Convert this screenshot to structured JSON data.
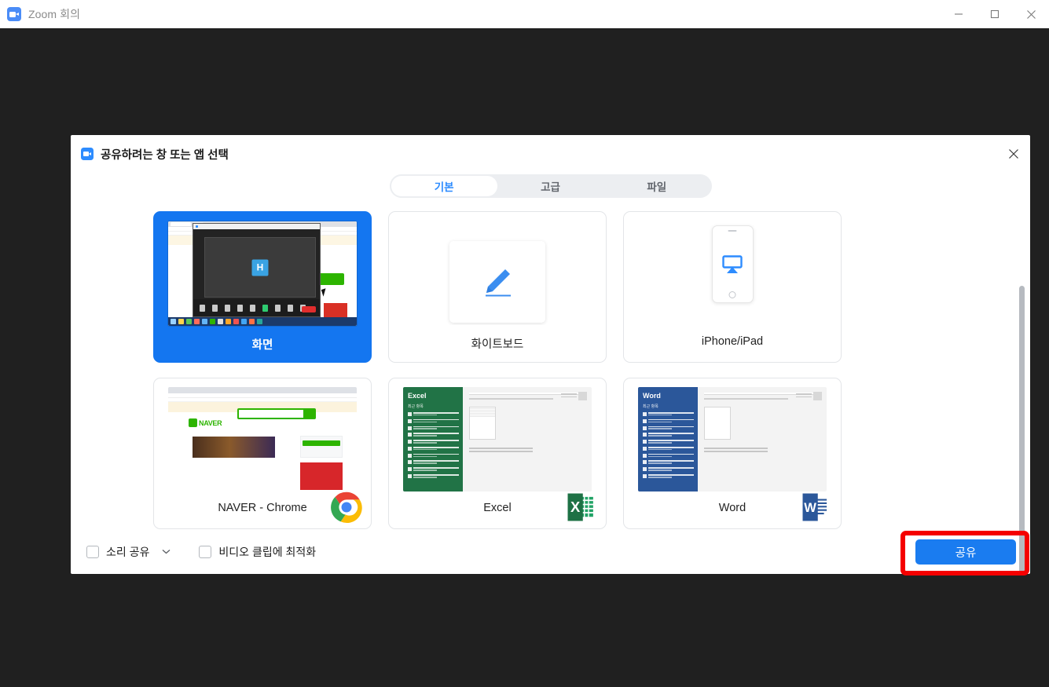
{
  "window": {
    "title": "Zoom 회의",
    "icon": "zoom-camera-icon",
    "controls": {
      "minimize": "—",
      "maximize": "□",
      "close": "✕"
    }
  },
  "dialog": {
    "title": "공유하려는 창 또는 앱 선택",
    "icon": "zoom-camera-icon",
    "close_icon": "close-icon",
    "tabs": [
      {
        "label": "기본",
        "active": true
      },
      {
        "label": "고급",
        "active": false
      },
      {
        "label": "파일",
        "active": false
      }
    ],
    "cards": [
      {
        "label": "화면",
        "selected": true,
        "badge": null,
        "thumb": "desktop-screenshot"
      },
      {
        "label": "화이트보드",
        "selected": false,
        "badge": null,
        "thumb": "whiteboard-pencil"
      },
      {
        "label": "iPhone/iPad",
        "selected": false,
        "badge": null,
        "thumb": "phone-airplay"
      },
      {
        "label": "NAVER - Chrome",
        "selected": false,
        "badge": "chrome-logo",
        "thumb": "naver-page"
      },
      {
        "label": "Excel",
        "selected": false,
        "badge": "excel-logo",
        "thumb": "excel-start",
        "brand": "Excel",
        "brand_sub": "최근 항목"
      },
      {
        "label": "Word",
        "selected": false,
        "badge": "word-logo",
        "thumb": "word-start",
        "brand": "Word",
        "brand_sub": "최근 항목"
      }
    ],
    "footer": {
      "share_audio_label": "소리 공유",
      "share_audio_checked": false,
      "audio_dropdown_icon": "chevron-down-icon",
      "optimize_label": "비디오 클립에 최적화",
      "optimize_checked": false,
      "share_button_label": "공유"
    },
    "annotation": {
      "target": "share-button",
      "color": "#f50000"
    }
  },
  "colors": {
    "accent_blue": "#1a7cf0",
    "selected_card": "#1476f0",
    "tab_active_text": "#2d8cff",
    "annotation_red": "#f50000",
    "backdrop": "#202020",
    "excel_green": "#217346",
    "word_blue": "#2b579a",
    "naver_green": "#2db400"
  }
}
